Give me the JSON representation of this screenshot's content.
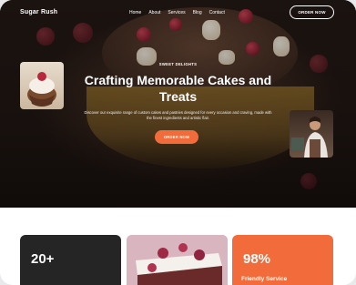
{
  "brand": {
    "name": "Sugar Rush"
  },
  "nav": {
    "items": [
      "Home",
      "About",
      "Services",
      "Blog",
      "Contact"
    ]
  },
  "header": {
    "order_button": "ORDER NOW"
  },
  "hero": {
    "eyebrow": "SWEET DELIGHTS",
    "title": "Crafting Memorable Cakes and Treats",
    "description": "Discover our exquisite range of custom cakes and pastries designed for every occasion and craving, made with the finest ingredients and artistic flair.",
    "cta": "ORDER NOW"
  },
  "cards": {
    "stat1": {
      "value": "20+"
    },
    "stat2": {
      "value": "98%",
      "label": "Friendly Service"
    }
  },
  "colors": {
    "accent": "#f26b3a",
    "dark_card": "#252525"
  }
}
